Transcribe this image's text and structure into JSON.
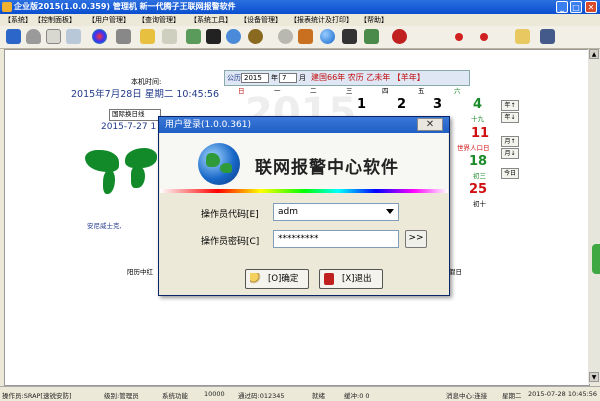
{
  "window": {
    "title": "企业版2015(1.0.0.359) 管理机 新一代腾子王联网报警软件",
    "buttons": {
      "minimize": "_",
      "maximize": "□",
      "close": "✕"
    }
  },
  "menu": [
    "【系统】",
    "【控制面板】",
    "【用户管理】",
    "【查询管理】",
    "【系统工具】",
    "【设备管理】",
    "【报表统计及打印】",
    "【帮助】"
  ],
  "toolbar": [
    "edit-icon",
    "user-icon",
    "card-icon",
    "screen-icon",
    "color-icon",
    "tools-icon",
    "key-icon",
    "folder-icon",
    "image-icon",
    "chart-icon",
    "network-icon",
    "disc-icon",
    "help-icon",
    "globe-icon",
    "monitor-icon",
    "book-icon",
    "alarm-icon",
    "red-dot-icon",
    "red-dot-icon",
    "folder-icon",
    "grid-icon"
  ],
  "background": {
    "clock_label": "本机时间:",
    "clock_value": "2015年7月28日 星期二  10:45:56",
    "tz_select": "国际换日线",
    "tz_date": "2015-7-27 1",
    "world_caption": "安尼威士克,",
    "lunar_strip_left": "阳历中红",
    "lunar_strip_right": "假日",
    "watermark": "2015",
    "calendar": {
      "label_year": "公历",
      "year": "2015",
      "year_suffix": "年",
      "month": "7",
      "month_suffix": "月",
      "lunar": "建国66年 农历 乙未年 【羊年】",
      "weekdays": [
        "日",
        "一",
        "二",
        "三",
        "四",
        "五",
        "六"
      ],
      "dates": [
        {
          "num": "2",
          "sub": ""
        },
        {
          "num": "3",
          "sub": ""
        },
        {
          "num": "4",
          "sub": "十九"
        },
        {
          "num": "11",
          "sub": "世界人口日"
        },
        {
          "num": "18",
          "sub": "初三"
        },
        {
          "num": "25",
          "sub": "初十"
        },
        {
          "num": "1",
          "sub": ""
        }
      ],
      "side_buttons": [
        "年↑",
        "年↓",
        "月↑",
        "月↓",
        "今日"
      ]
    }
  },
  "dialog": {
    "title": "用户登录(1.0.0.361)",
    "close": "✕",
    "banner": "联网报警中心软件",
    "operator_code_label": "操作员代码[E]",
    "operator_code_value": "adm",
    "operator_pwd_label": "操作员密码[C]",
    "operator_pwd_value": "*********",
    "go_label": ">>",
    "ok_label": "[O]确定",
    "exit_label": "[X]退出"
  },
  "status": {
    "operator": "操作员:SRAP[速锐安防]",
    "level": "级别:管理员",
    "function_label": "系统功能",
    "function_value": "10000",
    "comm": "通过码:012345",
    "state": "就绪",
    "buffer": "缓冲:0  0",
    "msg_center": "消息中心:连接",
    "weekday": "星期二",
    "datetime": "2015-07-28 10:45:56"
  },
  "colors": {
    "titlebar": "#0a4fd0",
    "dialog_title": "#1f5fc4",
    "green_day": "#1a8a2a",
    "red_day": "#d01010"
  }
}
